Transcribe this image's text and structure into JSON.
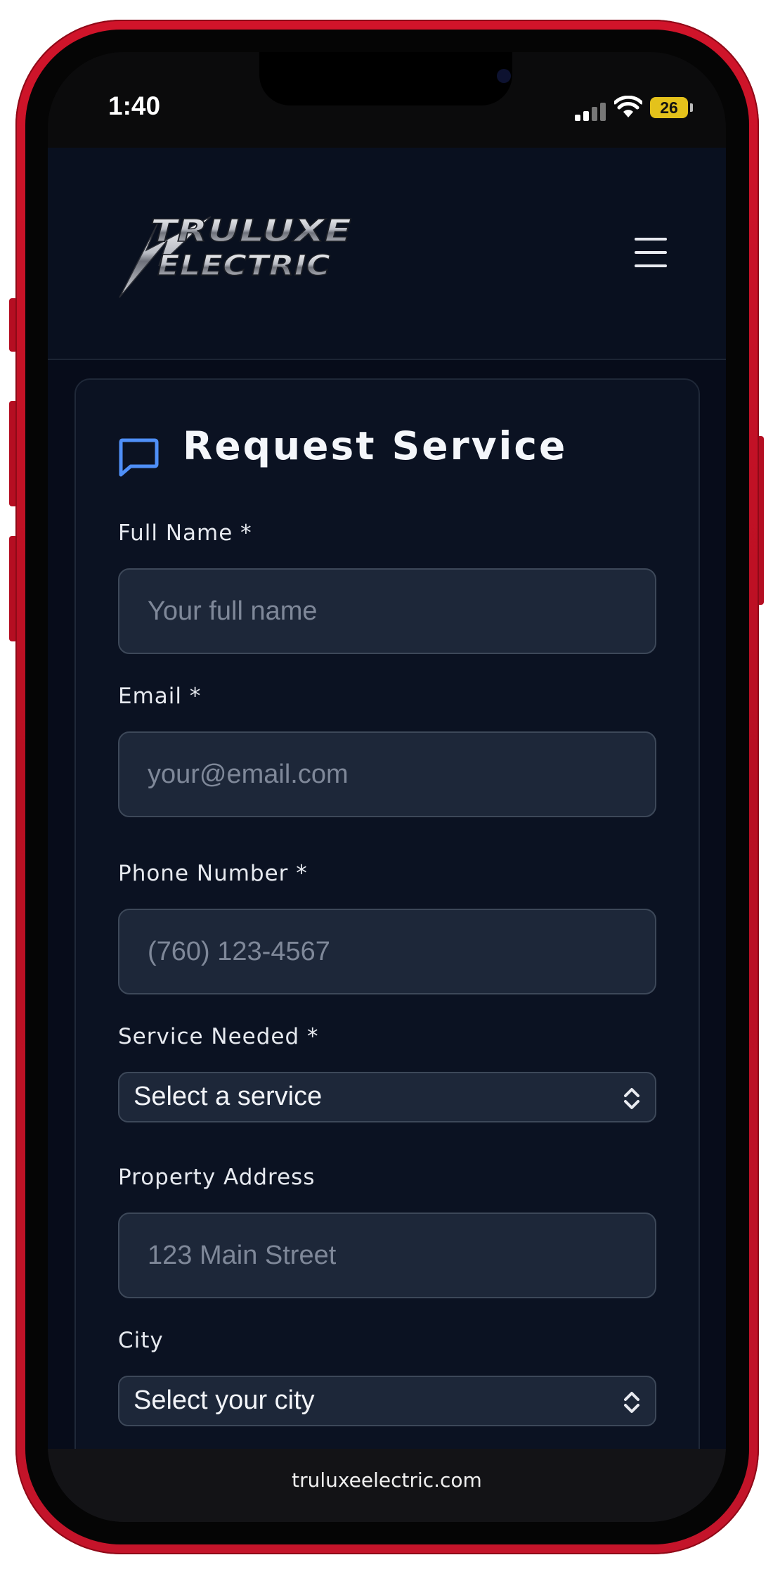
{
  "status_bar": {
    "time": "1:40",
    "battery": "26"
  },
  "header": {
    "logo_line1": "TRULUXE",
    "logo_line2": "ELECTRIC",
    "menu_icon": "hamburger-menu-icon"
  },
  "form": {
    "title": "Request Service",
    "title_icon": "chat-bubble-icon",
    "accent_color": "#3b82f6",
    "fields": {
      "full_name": {
        "label": "Full Name *",
        "placeholder": "Your full name"
      },
      "email": {
        "label": "Email *",
        "placeholder": "your@email.com"
      },
      "phone": {
        "label": "Phone Number *",
        "placeholder": "(760) 123-4567"
      },
      "service": {
        "label": "Service Needed *",
        "value": "Select a service"
      },
      "address": {
        "label": "Property Address",
        "placeholder": "123 Main Street"
      },
      "city": {
        "label": "City",
        "value": "Select your city"
      }
    }
  },
  "browser": {
    "url": "truluxeelectric.com"
  }
}
